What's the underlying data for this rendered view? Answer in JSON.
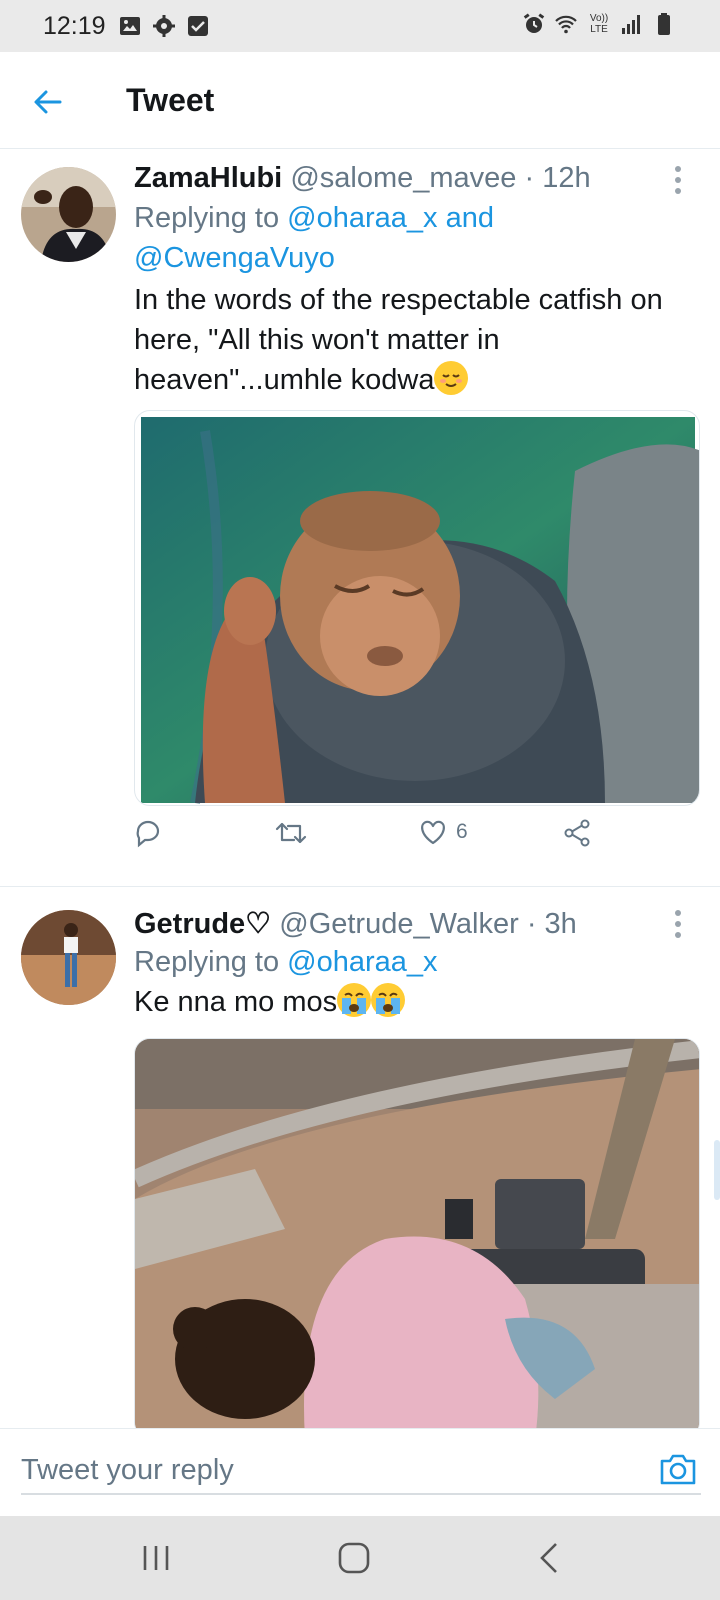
{
  "status_bar": {
    "time": "12:19",
    "network_label": "Vo)) LTE"
  },
  "header": {
    "title": "Tweet"
  },
  "tweets": [
    {
      "name": "ZamaHlubi",
      "handle": "@salome_mavee",
      "time": "· 12h",
      "replying_prefix": "Replying to",
      "replying_to": "@oharaa_x and @CwengaVuyo",
      "text": "In the words of the respectable catfish on here, \"All this won't matter in heaven\"...umhle kodwa",
      "emoji": "relieved-face-emoji",
      "like_count": "6"
    },
    {
      "name": "Getrude♡",
      "handle": "@Getrude_Walker",
      "time": "· 3h",
      "replying_prefix": "Replying to",
      "replying_to": "@oharaa_x",
      "text": "Ke nna mo mos",
      "emoji": "loudly-crying-face-emoji"
    }
  ],
  "composer": {
    "placeholder": "Tweet your reply"
  },
  "colors": {
    "accent": "#1b95e0",
    "secondary_text": "#657786",
    "divider": "#e6ecf0"
  }
}
